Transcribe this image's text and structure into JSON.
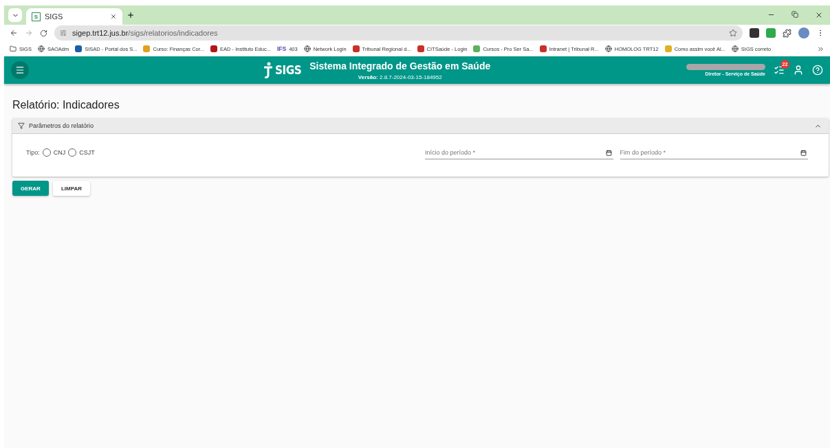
{
  "browser": {
    "tab": {
      "title": "SIGS",
      "favicon": "S",
      "selected": true
    },
    "url_host": "sigep.trt12.jus.br",
    "url_path": "/sigs/relatorios/indicadores",
    "bookmarks": [
      {
        "kind": "folder",
        "label": "SIGS"
      },
      {
        "kind": "globe",
        "label": "SAOAdm"
      },
      {
        "kind": "site",
        "label": "SISAD - Portal dos S...",
        "color": "#1a5fa8"
      },
      {
        "kind": "site",
        "label": "Curso: Finanças Cor...",
        "color": "#e0a020"
      },
      {
        "kind": "site",
        "label": "EAD - Instituto Educ...",
        "color": "#b01818"
      },
      {
        "kind": "text",
        "label": "403",
        "mark": "IFS"
      },
      {
        "kind": "globe",
        "label": "Network Login"
      },
      {
        "kind": "site",
        "label": "Tribunal Regional d...",
        "color": "#c83028"
      },
      {
        "kind": "site",
        "label": "CITSaúde - Login",
        "color": "#c83028"
      },
      {
        "kind": "site",
        "label": "Cursos - Pro Ser Sa...",
        "color": "#60b060"
      },
      {
        "kind": "site",
        "label": "Intranet | Tribunal R...",
        "color": "#c83028"
      },
      {
        "kind": "globe",
        "label": "HOMOLOG TRT12"
      },
      {
        "kind": "site",
        "label": "Como assim você Al...",
        "color": "#e0b020"
      },
      {
        "kind": "globe",
        "label": "SIGS correto"
      }
    ]
  },
  "app": {
    "logo": "SIGS",
    "title": "Sistema Integrado de Gestão em Saúde",
    "version": "**Versão:** 2.8.7-2024-03-15-184952",
    "role": "Diretor - Serviço de Saúde",
    "notifications": "22"
  },
  "page": {
    "heading": "Relatório: Indicadores",
    "panel": {
      "title": "Parâmetros do relatório",
      "expanded": true,
      "tipo_label": "Tipo:",
      "options": [
        {
          "label": "CNJ",
          "selected": false
        },
        {
          "label": "CSJT",
          "selected": false
        }
      ],
      "fields": [
        {
          "placeholder": "Início do período *"
        },
        {
          "placeholder": "Fim do período *"
        }
      ]
    },
    "buttons": [
      {
        "label": "GERAR",
        "kind": "primary"
      },
      {
        "label": "LIMPAR",
        "kind": "secondary"
      }
    ]
  }
}
